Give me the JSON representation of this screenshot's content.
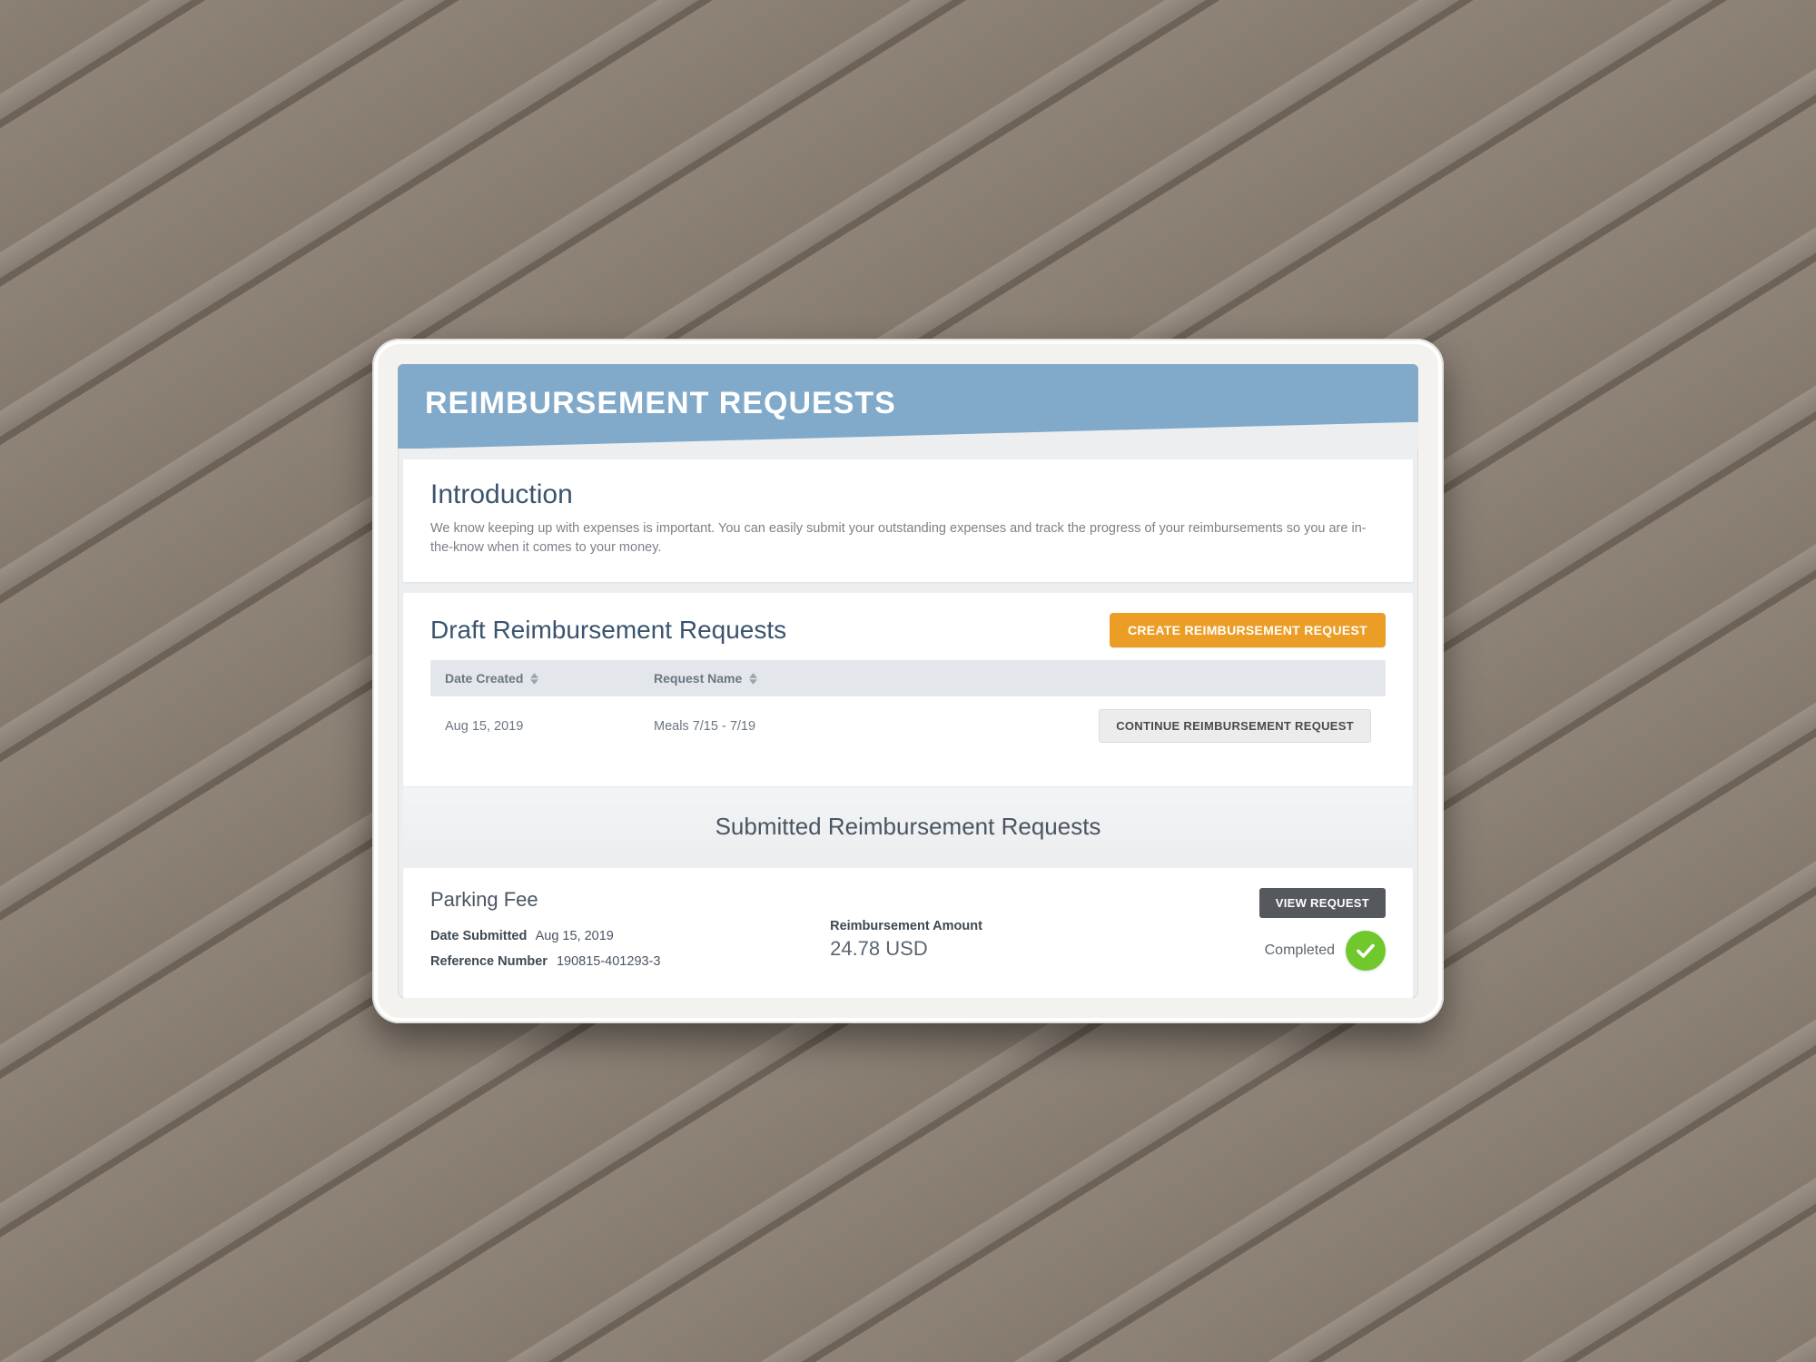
{
  "banner": {
    "title": "REIMBURSEMENT REQUESTS"
  },
  "intro": {
    "heading": "Introduction",
    "body": "We know keeping up with expenses is important. You can easily submit your outstanding expenses and track the progress of your reimbursements so you are in-the-know when it comes to your money."
  },
  "drafts": {
    "heading": "Draft Reimbursement Requests",
    "create_label": "CREATE REIMBURSEMENT REQUEST",
    "columns": {
      "date": "Date Created",
      "name": "Request Name"
    },
    "rows": [
      {
        "date": "Aug 15, 2019",
        "name": "Meals 7/15 - 7/19",
        "action_label": "CONTINUE REIMBURSEMENT REQUEST"
      }
    ]
  },
  "submitted": {
    "heading": "Submitted Reimbursement Requests",
    "items": [
      {
        "title": "Parking Fee",
        "date_submitted_label": "Date Submitted",
        "date_submitted": "Aug 15, 2019",
        "reference_label": "Reference Number",
        "reference": "190815-401293-3",
        "amount_label": "Reimbursement Amount",
        "amount": "24.78 USD",
        "view_label": "VIEW REQUEST",
        "status": "Completed"
      }
    ]
  }
}
